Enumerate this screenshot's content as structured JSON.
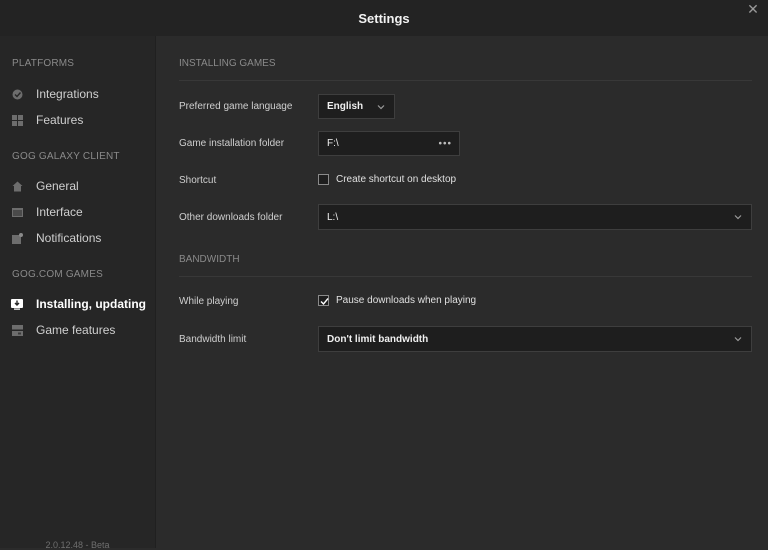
{
  "window": {
    "title": "Settings"
  },
  "sidebar": {
    "sections": [
      {
        "heading": "PLATFORMS",
        "items": [
          {
            "label": "Integrations",
            "icon": "integrations-icon"
          },
          {
            "label": "Features",
            "icon": "features-grid-icon"
          }
        ]
      },
      {
        "heading": "GOG GALAXY CLIENT",
        "items": [
          {
            "label": "General",
            "icon": "home-icon"
          },
          {
            "label": "Interface",
            "icon": "interface-icon"
          },
          {
            "label": "Notifications",
            "icon": "notifications-icon"
          }
        ]
      },
      {
        "heading": "GOG.COM GAMES",
        "items": [
          {
            "label": "Installing, updating",
            "icon": "download-icon",
            "active": true
          },
          {
            "label": "Game features",
            "icon": "game-features-icon"
          }
        ]
      }
    ],
    "version": "2.0.12.48 - Beta"
  },
  "main": {
    "installing": {
      "heading": "INSTALLING GAMES",
      "language_label": "Preferred game language",
      "language_value": "English",
      "folder_label": "Game installation folder",
      "folder_value": "F:\\",
      "shortcut_label": "Shortcut",
      "shortcut_checkbox_label": "Create shortcut on desktop",
      "shortcut_checked": false,
      "other_label": "Other downloads folder",
      "other_value": "L:\\"
    },
    "bandwidth": {
      "heading": "BANDWIDTH",
      "while_label": "While playing",
      "pause_label": "Pause downloads when playing",
      "pause_checked": true,
      "limit_label": "Bandwidth limit",
      "limit_value": "Don't limit bandwidth"
    }
  },
  "colors": {
    "background": "#2b2b2b",
    "sidebar": "#262626",
    "titlebar": "#232323",
    "field": "#1e1e1e",
    "text": "#d8d8d8",
    "muted": "#8a8a8a"
  }
}
